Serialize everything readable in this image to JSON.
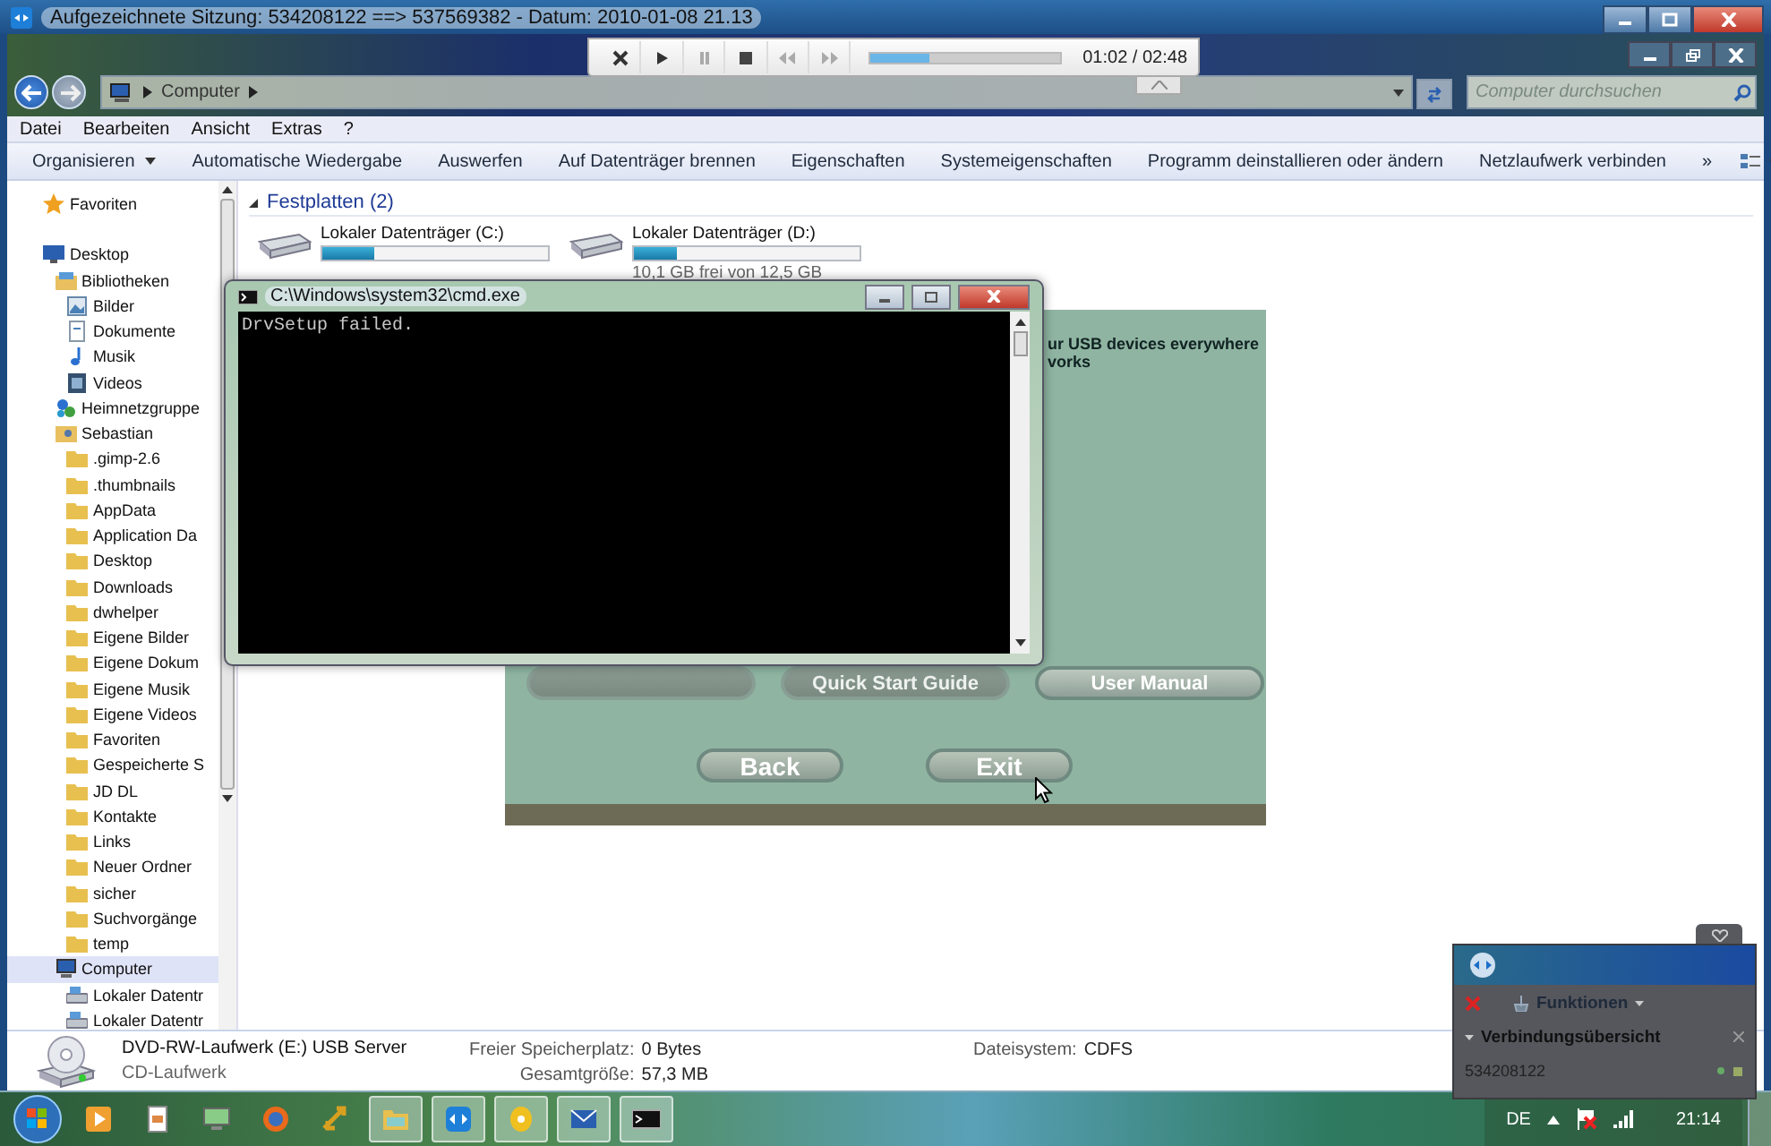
{
  "title_bar": {
    "title": "Aufgezeichnete Sitzung: 534208122 ==> 537569382 - Datum: 2010-01-08 21.13"
  },
  "player": {
    "level": 0.31,
    "time": "01:02 / 02:48"
  },
  "explorer": {
    "address": [
      "Computer"
    ],
    "search": {
      "placeholder": "Computer durchsuchen"
    },
    "menu": [
      "Datei",
      "Bearbeiten",
      "Ansicht",
      "Extras",
      "?"
    ],
    "toolbar": [
      {
        "label": "Organisieren",
        "dropdown": true
      },
      {
        "label": "Automatische Wiedergabe",
        "dropdown": false
      },
      {
        "label": "Auswerfen",
        "dropdown": false
      },
      {
        "label": "Auf Datenträger brennen",
        "dropdown": false
      },
      {
        "label": "Eigenschaften",
        "dropdown": false
      },
      {
        "label": "Systemeigenschaften",
        "dropdown": false
      },
      {
        "label": "Programm deinstallieren oder ändern",
        "dropdown": false
      },
      {
        "label": "Netzlaufwerk verbinden",
        "dropdown": false
      },
      {
        "label": "»",
        "dropdown": false
      }
    ],
    "sidebar": [
      {
        "label": "Favoriten",
        "kind": "star",
        "selected": false
      },
      {
        "label": "Desktop",
        "kind": "desktop",
        "selected": false,
        "children": [
          {
            "label": "Bibliotheken",
            "kind": "library",
            "selected": false,
            "children": [
              {
                "label": "Bilder",
                "kind": "picture",
                "selected": false
              },
              {
                "label": "Dokumente",
                "kind": "document",
                "selected": false
              },
              {
                "label": "Musik",
                "kind": "music",
                "selected": false
              },
              {
                "label": "Videos",
                "kind": "video",
                "selected": false
              }
            ]
          },
          {
            "label": "Heimnetzgruppe",
            "kind": "network",
            "selected": false
          },
          {
            "label": "Sebastian",
            "kind": "user",
            "selected": false,
            "children": [
              {
                "label": ".gimp-2.6",
                "kind": "folder",
                "selected": false
              },
              {
                "label": ".thumbnails",
                "kind": "folder",
                "selected": false
              },
              {
                "label": "AppData",
                "kind": "folder",
                "selected": false
              },
              {
                "label": "Application Da",
                "kind": "folder",
                "selected": false
              },
              {
                "label": "Desktop",
                "kind": "folder",
                "selected": false
              },
              {
                "label": "Downloads",
                "kind": "folder",
                "selected": false
              },
              {
                "label": "dwhelper",
                "kind": "folder",
                "selected": false
              },
              {
                "label": "Eigene Bilder",
                "kind": "folder",
                "selected": false
              },
              {
                "label": "Eigene Dokum",
                "kind": "folder",
                "selected": false
              },
              {
                "label": "Eigene Musik",
                "kind": "folder",
                "selected": false
              },
              {
                "label": "Eigene Videos",
                "kind": "folder",
                "selected": false
              },
              {
                "label": "Favoriten",
                "kind": "folder",
                "selected": false
              },
              {
                "label": "Gespeicherte S",
                "kind": "folder",
                "selected": false
              },
              {
                "label": "JD DL",
                "kind": "folder",
                "selected": false
              },
              {
                "label": "Kontakte",
                "kind": "folder",
                "selected": false
              },
              {
                "label": "Links",
                "kind": "folder",
                "selected": false
              },
              {
                "label": "Neuer Ordner",
                "kind": "folder",
                "selected": false
              },
              {
                "label": "sicher",
                "kind": "folder",
                "selected": false
              },
              {
                "label": "Suchvorgänge",
                "kind": "folder",
                "selected": false
              },
              {
                "label": "temp",
                "kind": "folder",
                "selected": false
              }
            ]
          },
          {
            "label": "Computer",
            "kind": "computer",
            "selected": true,
            "children": [
              {
                "label": "Lokaler Datentr",
                "kind": "drive",
                "selected": false
              },
              {
                "label": "Lokaler Datentr",
                "kind": "drive",
                "selected": false
              }
            ]
          }
        ]
      }
    ],
    "group": {
      "title": "Festplatten (2)",
      "drives": [
        {
          "name": "Lokaler Datenträger (C:)",
          "level": 0.23
        },
        {
          "name": "Lokaler Datenträger (D:)",
          "level": 0.19,
          "free": "10,1 GB frei von 12,5 GB"
        }
      ]
    },
    "details": {
      "name": "DVD-RW-Laufwerk (E:) USB Server",
      "type": "CD-Laufwerk",
      "fields": [
        {
          "label": "Freier Speicherplatz:",
          "value": "0 Bytes"
        },
        {
          "label": "Gesamtgröße:",
          "value": "57,3 MB"
        },
        {
          "label": "Dateisystem:",
          "value": "CDFS"
        }
      ]
    }
  },
  "installer": {
    "text": [
      "ur USB devices everywhere",
      "vorks"
    ],
    "buttons": [
      {
        "faded": true
      },
      {
        "label": "Quick Start Guide",
        "faded": true
      },
      {
        "label": "User Manual",
        "faded": false
      }
    ],
    "nav": [
      "Back",
      "Exit"
    ]
  },
  "cmd_window": {
    "title": "C:\\Windows\\system32\\cmd.exe",
    "output": "DrvSetup failed."
  },
  "remote_panel": {
    "menu": "Funktionen",
    "section": "Verbindungsübersicht",
    "sessions": [
      "534208122"
    ]
  },
  "taskbar": {
    "items": [
      {
        "kind": "player",
        "open": false
      },
      {
        "kind": "document",
        "open": false
      },
      {
        "kind": "monitor",
        "open": false
      },
      {
        "kind": "globe",
        "open": false
      },
      {
        "kind": "arrows",
        "open": false
      },
      {
        "kind": "folder",
        "open": true
      },
      {
        "kind": "remote",
        "open": true
      },
      {
        "kind": "disc",
        "open": true
      },
      {
        "kind": "envelope",
        "open": true
      },
      {
        "kind": "console",
        "open": true
      }
    ],
    "language": "DE",
    "clock": "21:14"
  }
}
